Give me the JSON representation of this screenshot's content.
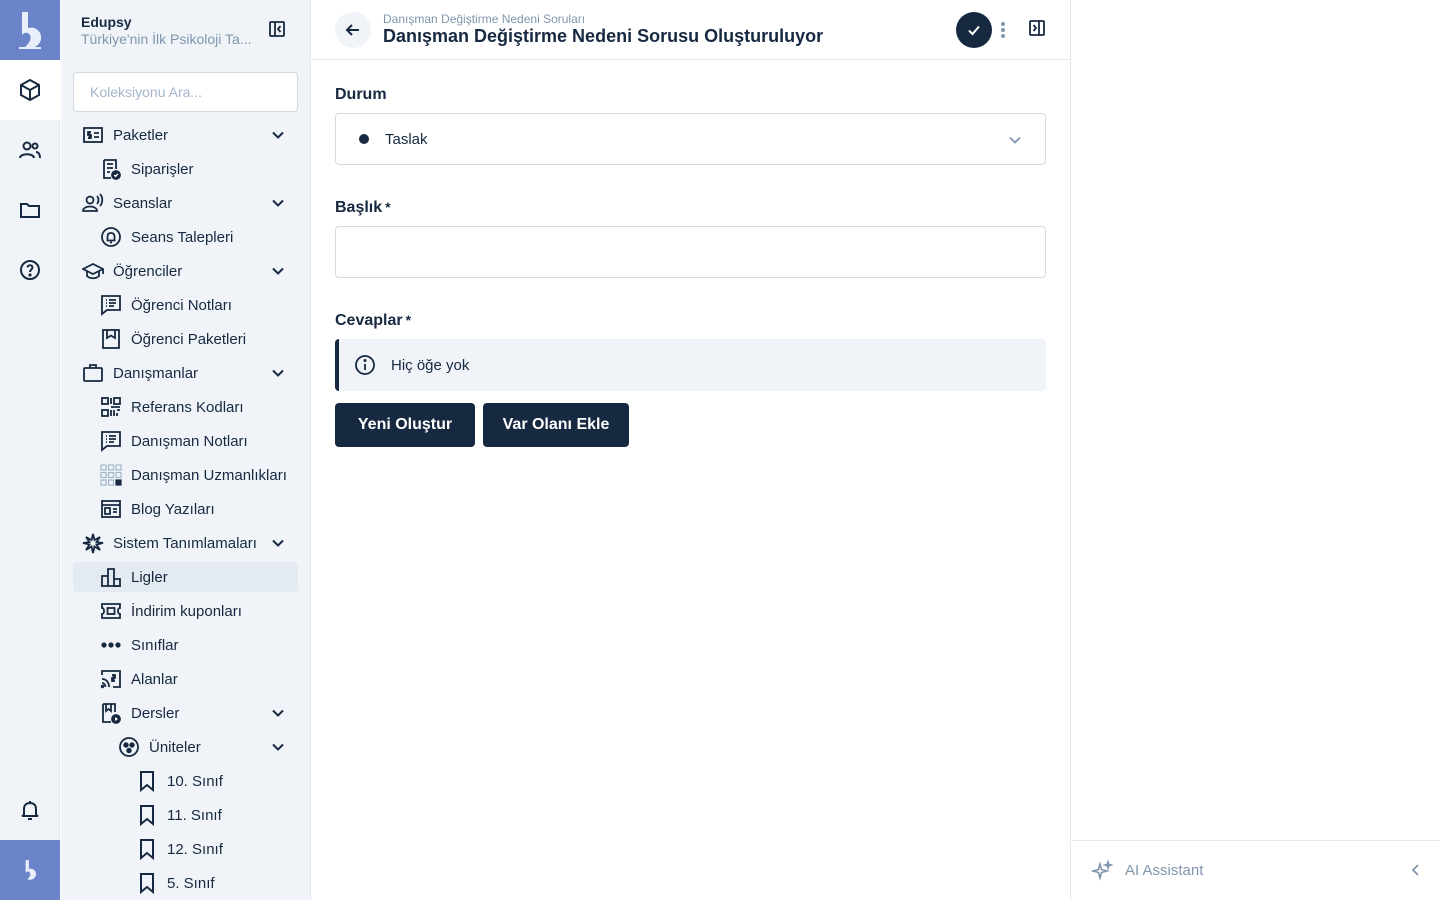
{
  "rail": {
    "logo_icon": "edupsy-logo",
    "items": [
      {
        "icon": "box-icon",
        "active": true
      },
      {
        "icon": "users-icon",
        "active": false
      },
      {
        "icon": "folder-icon",
        "active": false
      },
      {
        "icon": "help-icon",
        "active": false
      }
    ],
    "bottom": [
      "bell-icon",
      "avatar"
    ]
  },
  "nav": {
    "title": "Edupsy",
    "subtitle": "Türkiye'nin İlk Psikoloji Ta...",
    "search_placeholder": "Koleksiyonu Ara...",
    "items": [
      {
        "label": "Paketler",
        "icon": "money-icon"
      },
      {
        "label": "Siparişler",
        "icon": "receipt-icon"
      },
      {
        "label": "Seanslar",
        "icon": "voice-icon"
      },
      {
        "label": "Seans Talepleri",
        "icon": "bell-circle-icon"
      },
      {
        "label": "Öğrenciler",
        "icon": "school-icon"
      },
      {
        "label": "Öğrenci Notları",
        "icon": "notes-icon"
      },
      {
        "label": "Öğrenci Paketleri",
        "icon": "package-icon"
      },
      {
        "label": "Danışmanlar",
        "icon": "briefcase-icon"
      },
      {
        "label": "Referans Kodları",
        "icon": "qr-icon"
      },
      {
        "label": "Danışman Notları",
        "icon": "notes-icon"
      },
      {
        "label": "Danışman Uzmanlıkları",
        "icon": "grid-icon"
      },
      {
        "label": "Blog Yazıları",
        "icon": "blog-icon"
      },
      {
        "label": "Sistem Tanımlamaları",
        "icon": "sparkle-icon"
      },
      {
        "label": "Ligler",
        "icon": "leaderboard-icon"
      },
      {
        "label": "İndirim kuponları",
        "icon": "coupon-icon"
      },
      {
        "label": "Sınıflar",
        "icon": "dots-icon"
      },
      {
        "label": "Alanlar",
        "icon": "cast-icon"
      },
      {
        "label": "Dersler",
        "icon": "book-icon"
      },
      {
        "label": "Üniteler",
        "icon": "circle-dots-icon"
      },
      {
        "label": "10. Sınıf",
        "icon": "bookmark-icon"
      },
      {
        "label": "11. Sınıf",
        "icon": "bookmark-icon"
      },
      {
        "label": "12. Sınıf",
        "icon": "bookmark-icon"
      },
      {
        "label": "5. Sınıf",
        "icon": "bookmark-icon"
      }
    ]
  },
  "header": {
    "breadcrumb": "Danışman Değiştirme Nedeni Soruları",
    "title": "Danışman Değiştirme Nedeni Sorusu Oluşturuluyor"
  },
  "form": {
    "status_label": "Durum",
    "status_value": "Taslak",
    "title_label": "Başlık",
    "title_value": "",
    "required_mark": "*",
    "answers_label": "Cevaplar",
    "empty_notice": "Hiç öğe yok",
    "create_new_label": "Yeni Oluştur",
    "add_existing_label": "Var Olanı Ekle"
  },
  "ai": {
    "label": "AI Assistant"
  }
}
